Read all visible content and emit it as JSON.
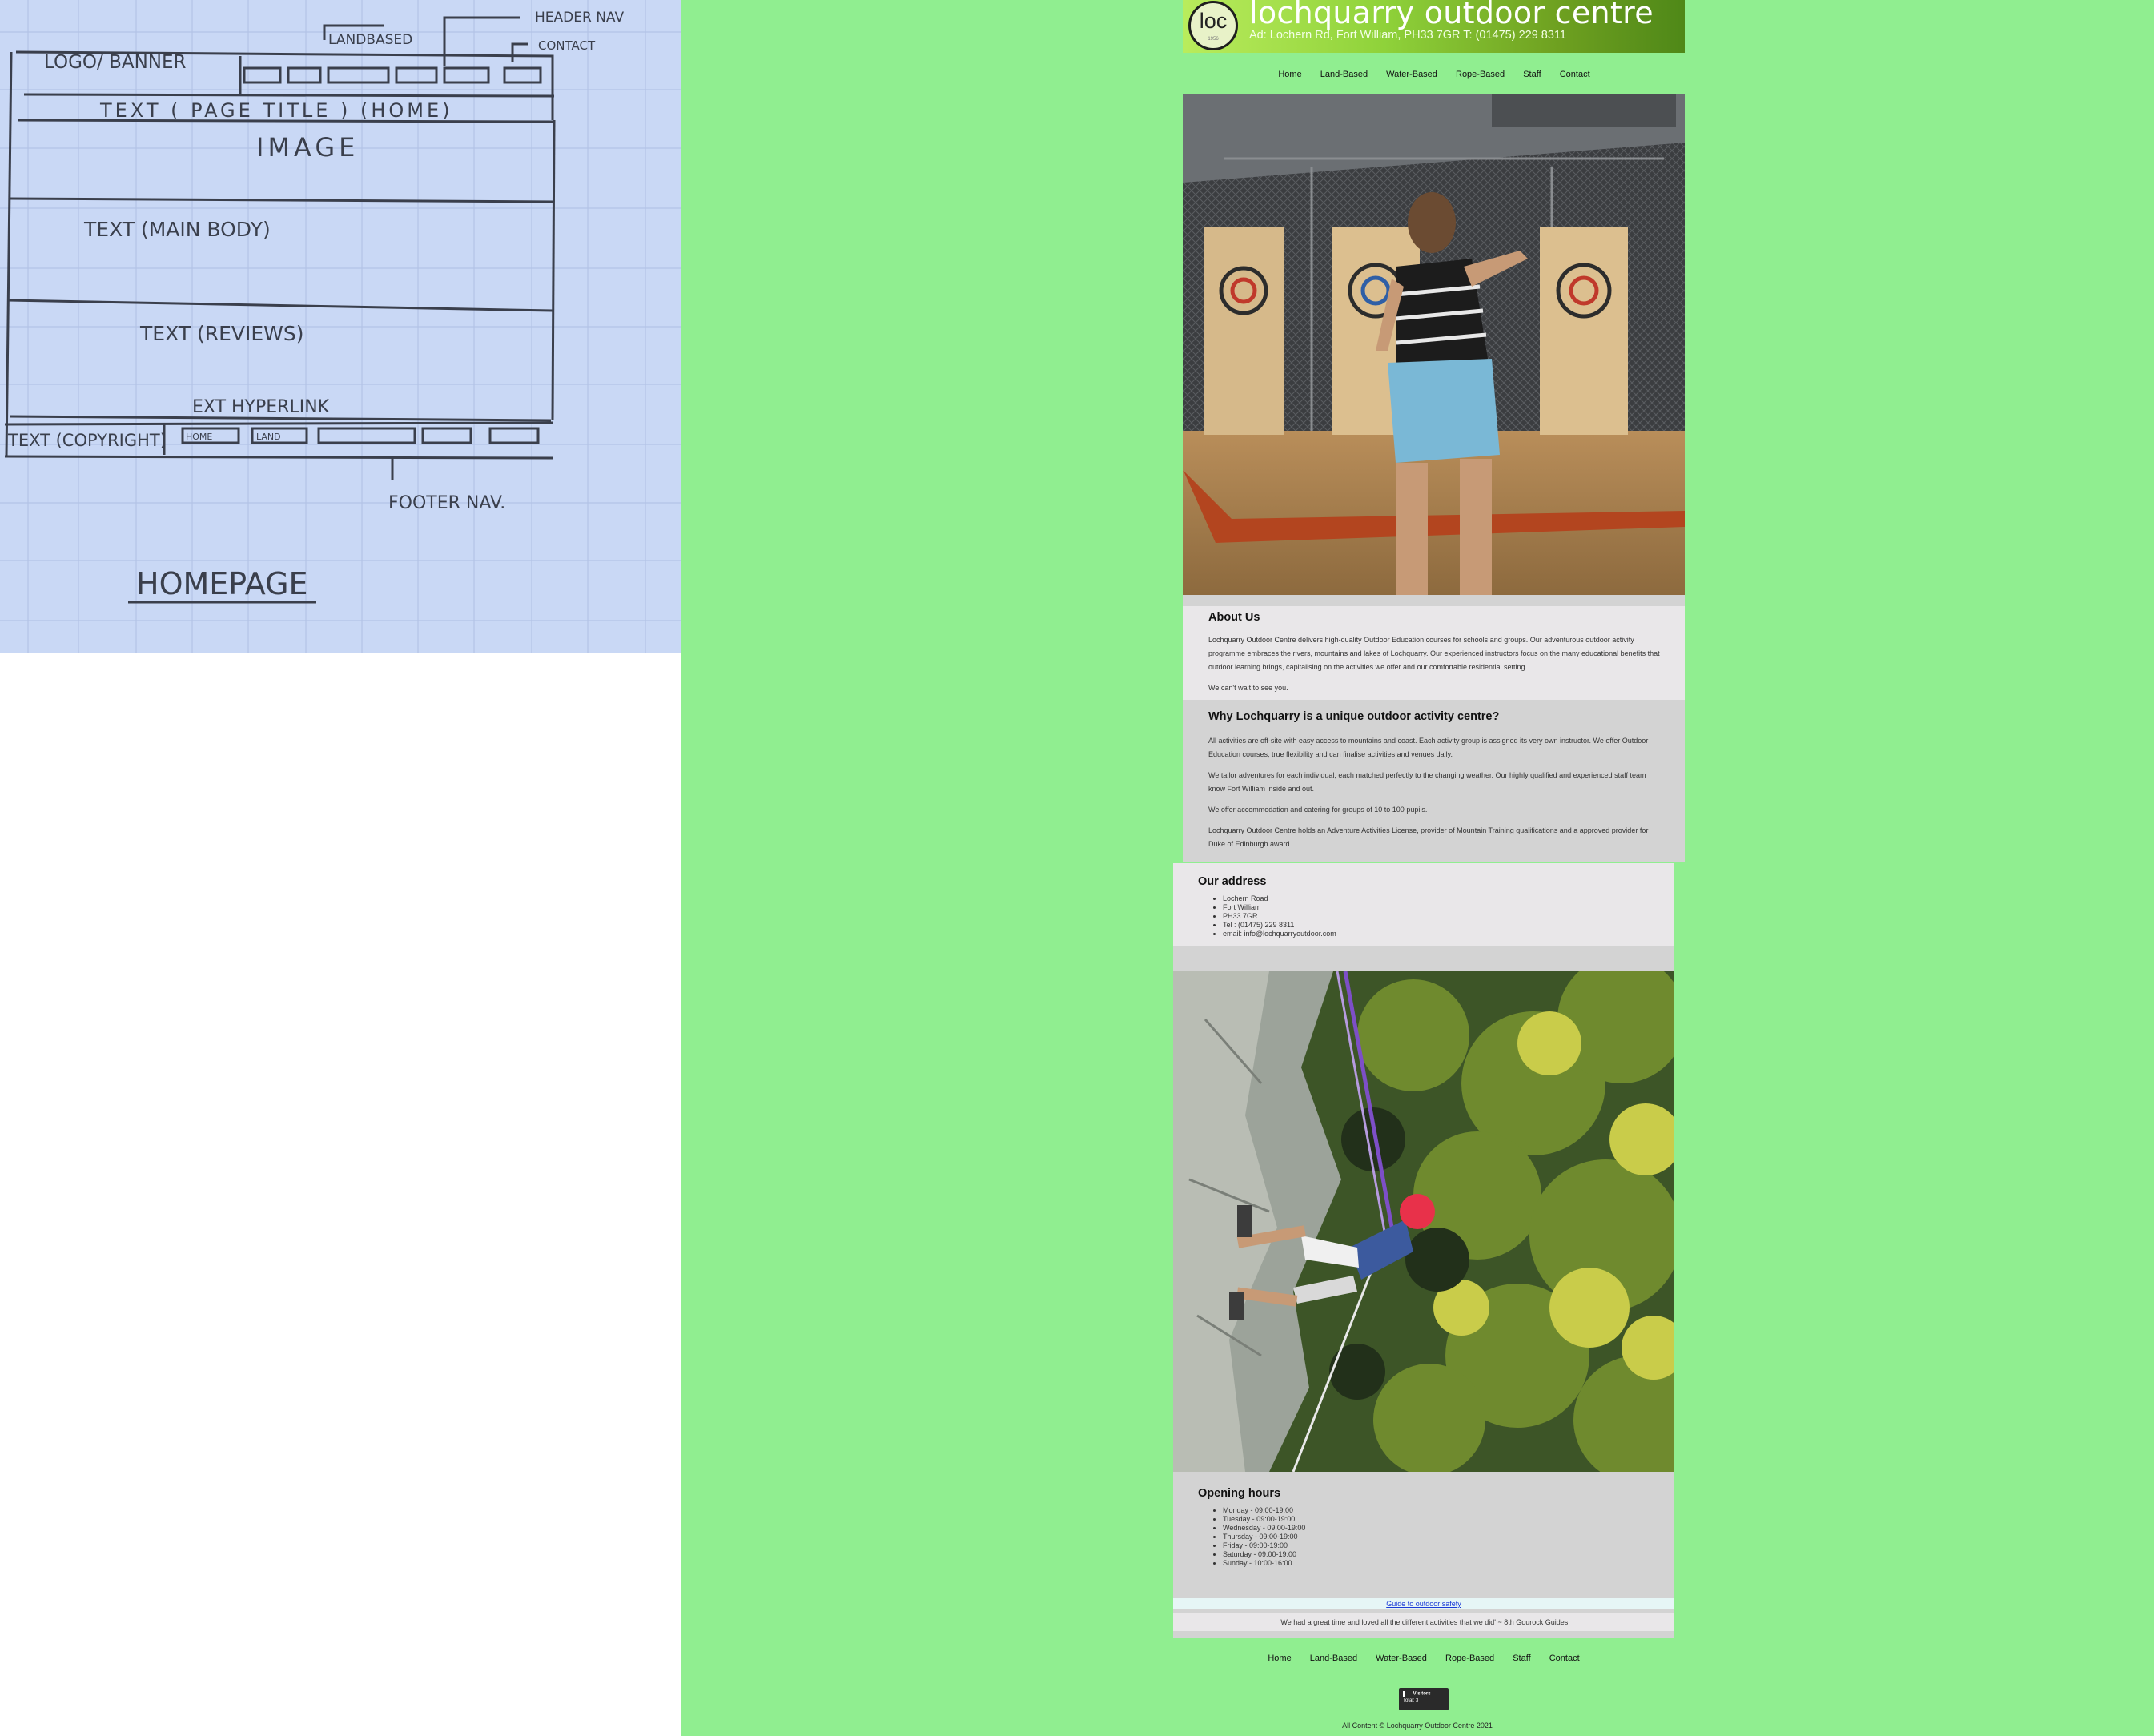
{
  "sketch": {
    "labels": {
      "logo_banner": "LOGO/ BANNER",
      "landbased": "LANDBASED",
      "header_nav": "HEADER NAV",
      "contact": "CONTACT",
      "page_title": "TEXT ( PAGE TITLE ) (HOME)",
      "image": "IMAGE",
      "text_main_body": "TEXT (MAIN BODY)",
      "text_reviews": "TEXT (REVIEWS)",
      "ext_hyperlink": "EXT HYPERLINK",
      "copyright": "TEXT (COPYRIGHT)",
      "footer_home": "HOME",
      "footer_land": "LAND",
      "footer_nav": "FOOTER NAV.",
      "homepage": "HOMEPAGE"
    }
  },
  "site": {
    "logo_text": "loc",
    "logo_small": "1956",
    "name": "lochquarry outdoor centre",
    "address_line": "Ad: Lochern Rd, Fort William, PH33 7GR T: (01475) 229 8311",
    "nav": [
      "Home",
      "Land-Based",
      "Water-Based",
      "Rope-Based",
      "Staff",
      "Contact"
    ],
    "about": {
      "title": "About Us",
      "p1": "Lochquarry Outdoor Centre delivers high-quality Outdoor Education courses for schools and groups. Our adventurous outdoor activity programme embraces the rivers, mountains and lakes of Lochquarry. Our experienced instructors focus on the many educational benefits that outdoor learning brings, capitalising on the activities we offer and our comfortable residential setting.",
      "p2": "We can't wait to see you."
    },
    "why": {
      "title": "Why Lochquarry is a unique outdoor activity centre?",
      "p1": "All activities are off-site with easy access to mountains and coast. Each activity group is assigned its very own instructor. We offer Outdoor Education courses, true flexibility and can finalise activities and venues daily.",
      "p2": "We tailor adventures for each individual, each matched perfectly to the changing weather. Our highly qualified and experienced staff team know Fort William inside and out.",
      "p3": "We offer accommodation and catering for groups of 10 to 100 pupils.",
      "p4": "Lochquarry Outdoor Centre holds an Adventure Activities License, provider of Mountain Training qualifications and a approved provider for Duke of Edinburgh award."
    },
    "address": {
      "title": "Our address",
      "items": [
        "Lochern Road",
        "Fort William",
        "PH33 7GR",
        "Tel : (01475) 229 8311",
        "email: info@lochquarryoutdoor.com"
      ]
    },
    "hours": {
      "title": "Opening hours",
      "items": [
        "Monday - 09:00-19:00",
        "Tuesday - 09:00-19:00",
        "Wednesday - 09:00-19:00",
        "Thursday - 09:00-19:00",
        "Friday - 09:00-19:00",
        "Saturday - 09:00-19:00",
        "Sunday - 10:00-16:00"
      ]
    },
    "guide_link": "Guide to outdoor safety",
    "review": "'We had a great time and loved all the different activities that we did' ~ 8th Gourock Guides",
    "counter": {
      "label": "Visitors",
      "total": "Total: 3"
    },
    "copyright": "All Content © Lochquarry Outdoor Centre 2021",
    "colors": {
      "page_bg": "#90ee90",
      "light_section": "#e9e7e9",
      "dark_section": "#d3d3d3",
      "link": "#1b3bd6"
    }
  }
}
